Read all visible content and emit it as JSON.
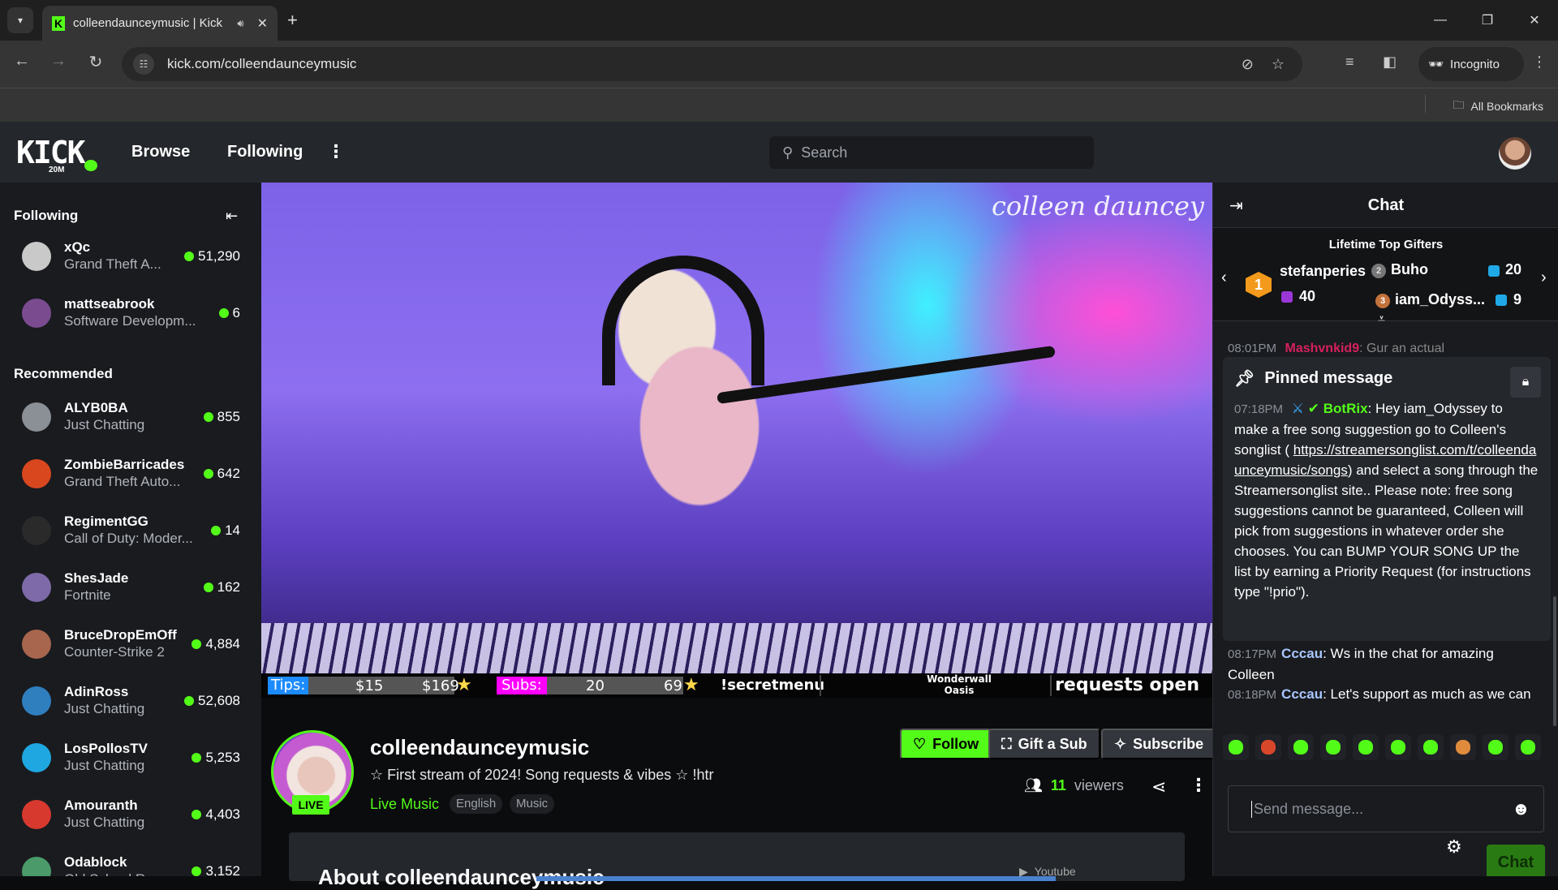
{
  "browser": {
    "tab_title": "colleendaunceymusic | Kick",
    "url": "kick.com/colleendaunceymusic",
    "incognito_label": "Incognito",
    "all_bookmarks_label": "All Bookmarks",
    "icons": {
      "tab_list": "chevron-down-icon",
      "audio": "speaker-icon",
      "close": "close-icon",
      "new_tab": "plus-icon",
      "back": "arrow-left-icon",
      "forward": "arrow-right-icon",
      "reload": "reload-icon",
      "site_info": "tune-icon",
      "eye_off": "eye-off-icon",
      "bookmark": "star-icon",
      "media": "media-queue-icon",
      "side_panel": "side-panel-icon",
      "menu": "kebab-icon"
    }
  },
  "header": {
    "logo": "KICK",
    "logo_badge": "20M",
    "nav": [
      "Browse",
      "Following"
    ],
    "search_placeholder": "Search"
  },
  "sidebar": {
    "following_title": "Following",
    "recommended_title": "Recommended",
    "following": [
      {
        "name": "xQc",
        "category": "Grand Theft A...",
        "viewers": "51,290",
        "avatar_color": "#c9c9c9"
      },
      {
        "name": "mattseabrook",
        "category": "Software Developm...",
        "viewers": "6",
        "avatar_color": "#7a4b8f"
      }
    ],
    "recommended": [
      {
        "name": "ALYB0BA",
        "category": "Just Chatting",
        "viewers": "855",
        "avatar_color": "#8b8f96"
      },
      {
        "name": "ZombieBarricades",
        "category": "Grand Theft Auto...",
        "viewers": "642",
        "avatar_color": "#d9471f"
      },
      {
        "name": "RegimentGG",
        "category": "Call of Duty: Moder...",
        "viewers": "14",
        "avatar_color": "#2a2a2a"
      },
      {
        "name": "ShesJade",
        "category": "Fortnite",
        "viewers": "162",
        "avatar_color": "#7e6aa8"
      },
      {
        "name": "BruceDropEmOff",
        "category": "Counter-Strike 2",
        "viewers": "4,884",
        "avatar_color": "#a7664d"
      },
      {
        "name": "AdinRoss",
        "category": "Just Chatting",
        "viewers": "52,608",
        "avatar_color": "#2f7fbf"
      },
      {
        "name": "LosPollosTV",
        "category": "Just Chatting",
        "viewers": "5,253",
        "avatar_color": "#1ea7e0"
      },
      {
        "name": "Amouranth",
        "category": "Just Chatting",
        "viewers": "4,403",
        "avatar_color": "#d8392f"
      },
      {
        "name": "Odablock",
        "category": "Old School R...",
        "viewers": "3,152",
        "avatar_color": "#4a9a6a"
      }
    ]
  },
  "video": {
    "watermark": "colleen dauncey",
    "overlay": {
      "tips_label": "Tips:",
      "tips_current": "$15",
      "tips_goal": "$169",
      "subs_label": "Subs:",
      "subs_current": "20",
      "subs_goal": "69",
      "command": "!secretmenu",
      "song_title": "Wonderwall",
      "song_artist": "Oasis",
      "requests": "requests open"
    }
  },
  "channel": {
    "name": "colleendaunceymusic",
    "live_label": "LIVE",
    "stream_title": "☆ First stream of 2024! Song requests & vibes ☆ !htr",
    "category": "Live Music",
    "tags": [
      "English",
      "Music"
    ],
    "follow_label": "Follow",
    "gift_label": "Gift a Sub",
    "subscribe_label": "Subscribe",
    "viewer_count": "11",
    "viewers_label": "viewers",
    "about_title": "About colleendaunceymusic",
    "about_social": "Youtube"
  },
  "chat": {
    "title": "Chat",
    "gifters_title": "Lifetime Top Gifters",
    "gifters": [
      {
        "rank": "1",
        "name": "stefanperies",
        "count": "40"
      },
      {
        "rank": "2",
        "name": "Buho",
        "count": "20"
      },
      {
        "rank": "3",
        "name": "iam_Odyss...",
        "count": "9"
      }
    ],
    "peek_message": {
      "time": "08:01PM",
      "user": "Mashvnkid9",
      "text": "Gur an actual"
    },
    "pinned": {
      "title": "Pinned message",
      "time": "07:18PM",
      "user": "BotRix",
      "text_before_link": ": Hey iam_Odyssey to make a free song suggestion go to Colleen's songlist ( ",
      "link": "https://streamersonglist.com/t/colleendaunceymusic/songs",
      "text_after_link": ") and select a song through the Streamersonglist site.. Please note: free song suggestions cannot be guaranteed, Colleen will pick from suggestions in whatever order she chooses. You can BUMP YOUR SONG UP the list by earning a Priority Request (for instructions type \"!prio\")."
    },
    "messages": [
      {
        "time": "08:17PM",
        "user": "Cccau",
        "text": "Ws in the chat for amazing Colleen"
      },
      {
        "time": "08:18PM",
        "user": "Cccau",
        "text": "Let's support as much as we can"
      }
    ],
    "emote_colors": [
      "#53fc18",
      "#d9472b",
      "#53fc18",
      "#53fc18",
      "#53fc18",
      "#53fc18",
      "#53fc18",
      "#e08a3c",
      "#53fc18",
      "#53fc18"
    ],
    "input_placeholder": "Send message...",
    "send_label": "Chat"
  },
  "colors": {
    "brand": "#53fc18",
    "tips": "#1c8bff",
    "subs": "#ff00ff"
  }
}
